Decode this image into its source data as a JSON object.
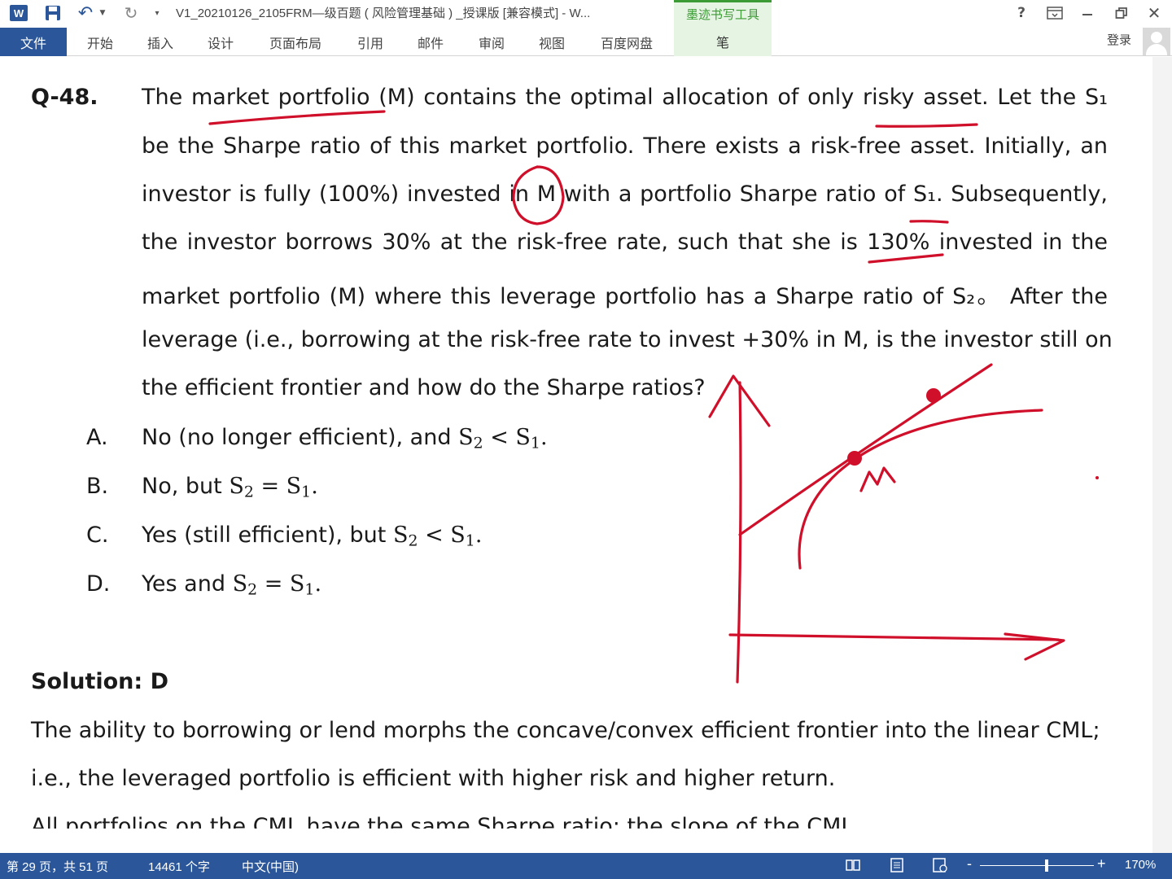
{
  "titlebar": {
    "word_icon": "W",
    "icons": [
      "word-icon",
      "save-icon",
      "undo-icon",
      "redo-icon",
      "customize-qat-icon"
    ],
    "doc_title": "V1_20210126_2105FRM—级百题 ( 风险管理基础 ) _授课版 [兼容模式] - W...",
    "ink_tools_label": "墨迹书写工具",
    "help": "?",
    "close": "✕"
  },
  "ribbon": {
    "file_tab": "文件",
    "tabs": [
      "开始",
      "插入",
      "设计",
      "页面布局",
      "引用",
      "邮件",
      "审阅",
      "视图",
      "百度网盘"
    ],
    "pen_tab": "笔",
    "sign_in": "登录"
  },
  "question": {
    "number": "Q-48.",
    "lines": [
      "The market portfolio (M) contains the optimal allocation of only risky asset. Let the S₁",
      "be the Sharpe ratio of this market portfolio. There exists a risk-free asset. Initially, an",
      "investor is fully (100%) invested in M with a portfolio Sharpe ratio of S₁. Subsequently,",
      "the investor borrows 30% at the risk-free rate, such that she is 130% invested in the",
      "market portfolio (M) where this leverage portfolio has a Sharpe ratio of S₂。 After the",
      "leverage (i.e., borrowing at the risk-free rate to invest +30% in M, is the investor still on",
      "the efficient frontier and how do the Sharpe ratios?"
    ],
    "options": [
      {
        "letter": "A.",
        "prefix": "No (no longer efficient), and",
        "a": "S",
        "a_sub": "2",
        "op": "<",
        "b": "S",
        "b_sub": "1",
        "end": "."
      },
      {
        "letter": "B.",
        "prefix": "No, but",
        "a": "S",
        "a_sub": "2",
        "op": "=",
        "b": "S",
        "b_sub": "1",
        "end": "."
      },
      {
        "letter": "C.",
        "prefix": "Yes (still efficient), but",
        "a": "S",
        "a_sub": "2",
        "op": "<",
        "b": "S",
        "b_sub": "1",
        "end": "."
      },
      {
        "letter": "D.",
        "prefix": "Yes and",
        "a": "S",
        "a_sub": "2",
        "op": "=",
        "b": "S",
        "b_sub": "1",
        "end": "."
      }
    ]
  },
  "solution": {
    "title": "Solution: D",
    "lines": [
      "The ability to borrowing or lend morphs the concave/convex efficient frontier into the linear CML;",
      "i.e., the leveraged portfolio is efficient with higher risk and higher return.",
      "All portfolios on the CML have the same Sharpe ratio: the slope of the CML"
    ]
  },
  "annotation": {
    "label": "M",
    "color": "#d0102a"
  },
  "statusbar": {
    "page": "第 29 页，共 51 页",
    "words": "14461 个字",
    "language": "中文(中国)",
    "zoom": "170%",
    "zoom_minus": "-",
    "zoom_plus": "+"
  }
}
